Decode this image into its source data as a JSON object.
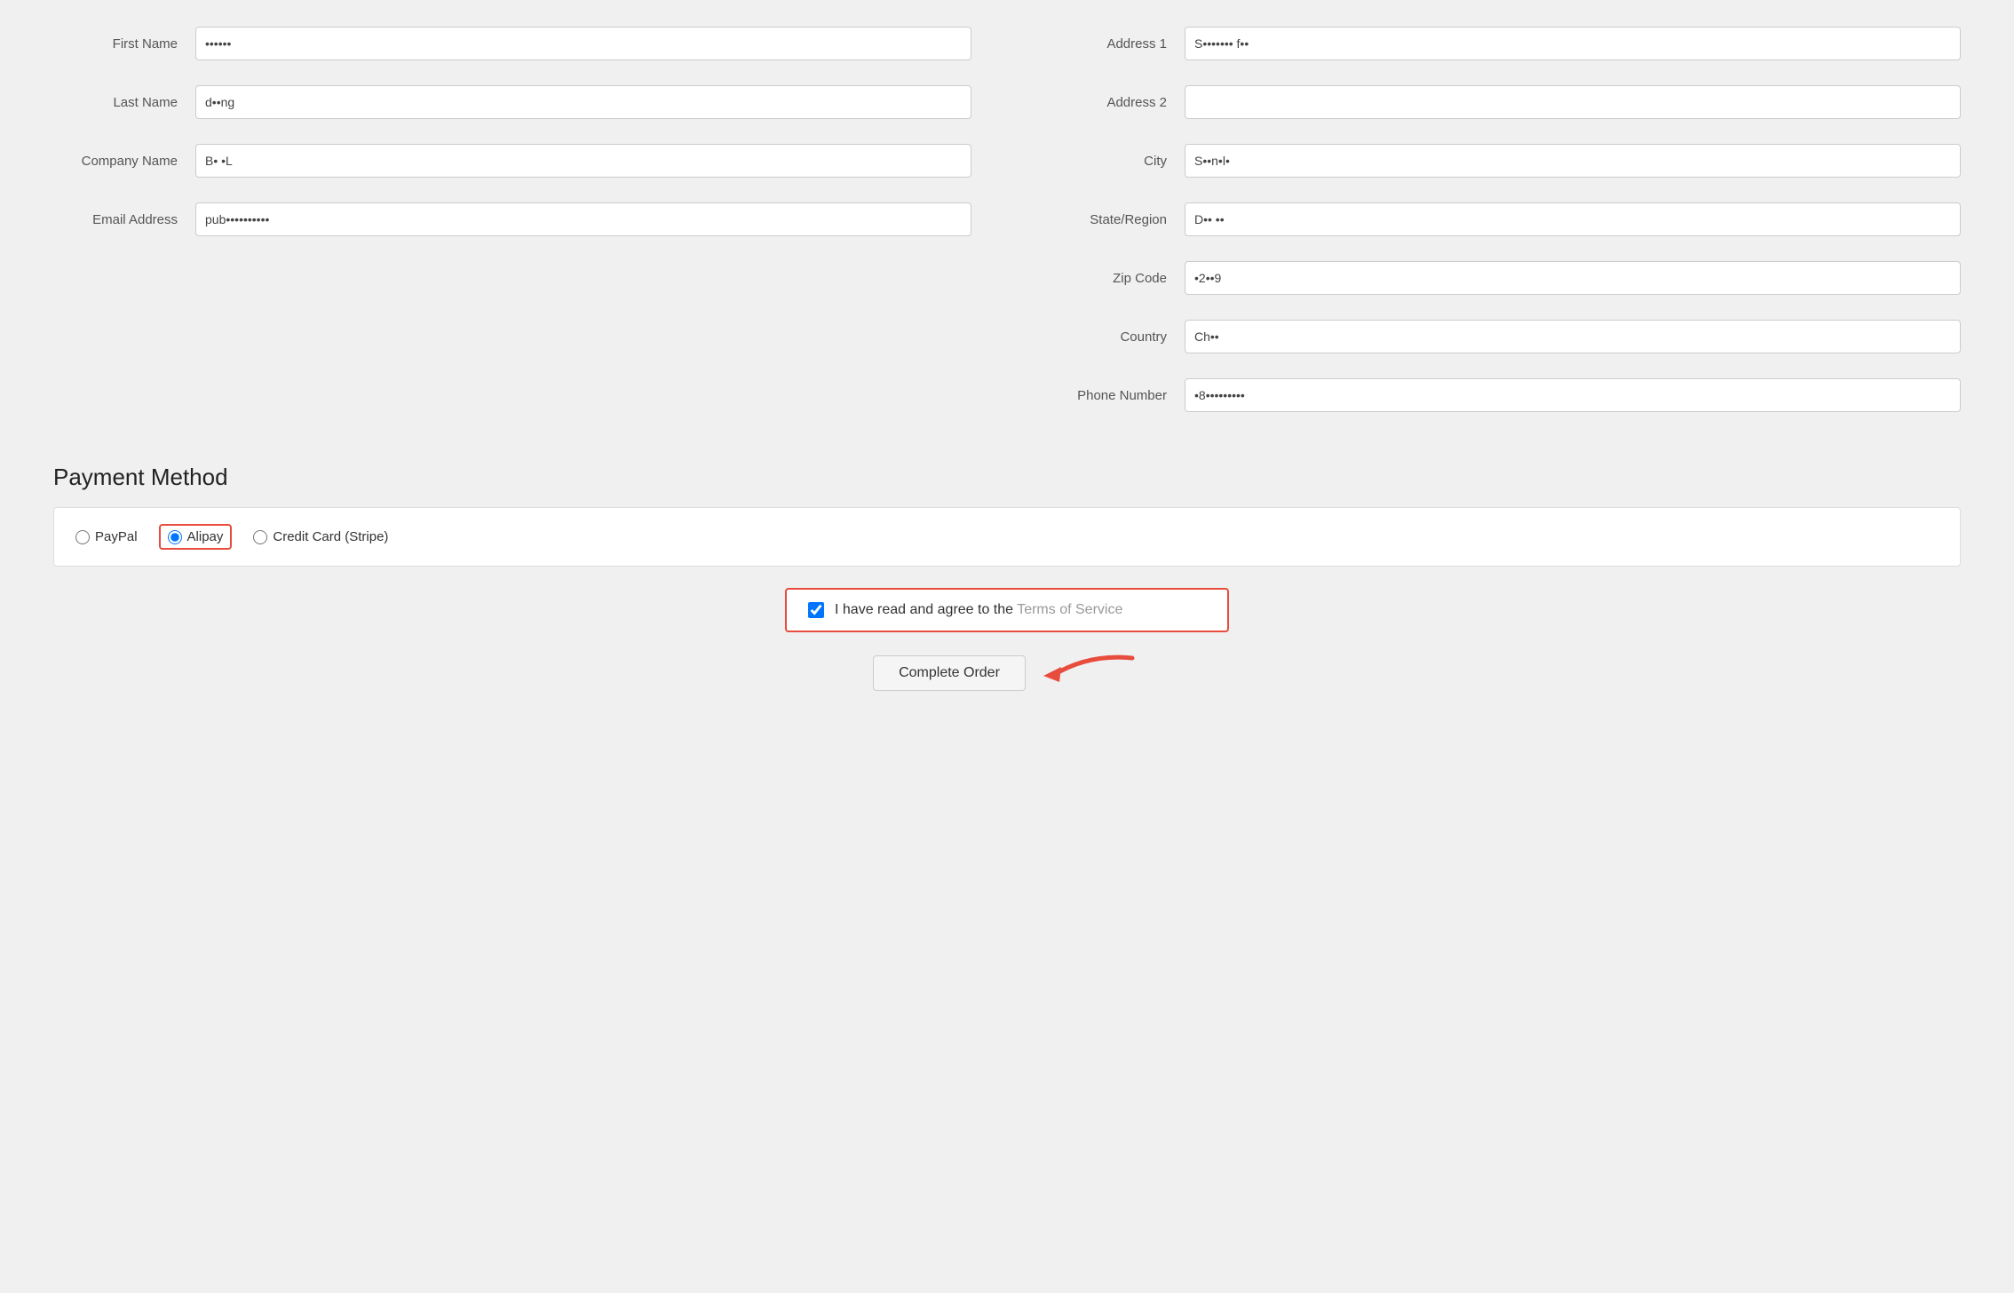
{
  "form": {
    "left": {
      "fields": [
        {
          "label": "First Name",
          "value": "••••••",
          "id": "first-name"
        },
        {
          "label": "Last Name",
          "value": "d••ng",
          "id": "last-name"
        },
        {
          "label": "Company Name",
          "value": "B• •L",
          "id": "company-name"
        },
        {
          "label": "Email Address",
          "value": "pub••••••••",
          "id": "email-address"
        }
      ]
    },
    "right": {
      "fields": [
        {
          "label": "Address 1",
          "value": "S••••••• f••",
          "id": "address1"
        },
        {
          "label": "Address 2",
          "value": "",
          "id": "address2"
        },
        {
          "label": "City",
          "value": "S••n•l•",
          "id": "city"
        },
        {
          "label": "State/Region",
          "value": "D•• ••",
          "id": "state"
        },
        {
          "label": "Zip Code",
          "value": "•2••9",
          "id": "zip"
        },
        {
          "label": "Country",
          "value": "Ch••",
          "id": "country"
        },
        {
          "label": "Phone Number",
          "value": "•8•••••••••",
          "id": "phone"
        }
      ]
    }
  },
  "payment": {
    "title": "Payment Method",
    "options": [
      {
        "id": "paypal",
        "label": "PayPal",
        "checked": false
      },
      {
        "id": "alipay",
        "label": "Alipay",
        "checked": true,
        "highlighted": true
      },
      {
        "id": "stripe",
        "label": "Credit Card (Stripe)",
        "checked": false
      }
    ]
  },
  "terms": {
    "prefix": "I have read and agree to the ",
    "link_text": "Terms of Service",
    "checked": true
  },
  "button": {
    "label": "Complete Order"
  }
}
